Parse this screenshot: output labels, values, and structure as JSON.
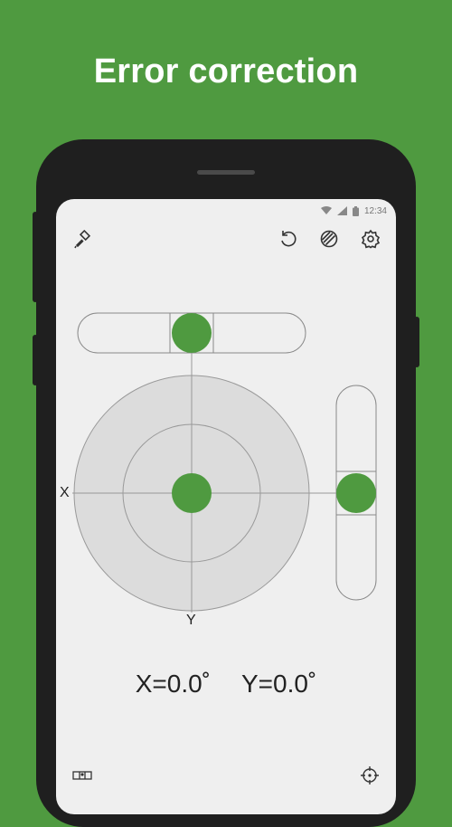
{
  "promo": {
    "headline": "Error correction"
  },
  "status_bar": {
    "time": "12:34",
    "icons": [
      "wifi-icon",
      "cell-signal-icon",
      "battery-icon"
    ]
  },
  "toolbar": {
    "left_icons": [
      "brush-icon"
    ],
    "right_icons": [
      "undo-icon",
      "calibrate-icon",
      "settings-icon"
    ]
  },
  "level": {
    "axis_x_label": "X",
    "axis_y_label": "Y",
    "x_value": "X=0.0˚",
    "y_value": "Y=0.0˚",
    "accent_color": "#4f9a40",
    "dial_fill": "#dcdcdc"
  },
  "bottom_bar": {
    "left_icon": "level-mode-icon",
    "right_icon": "target-icon"
  }
}
